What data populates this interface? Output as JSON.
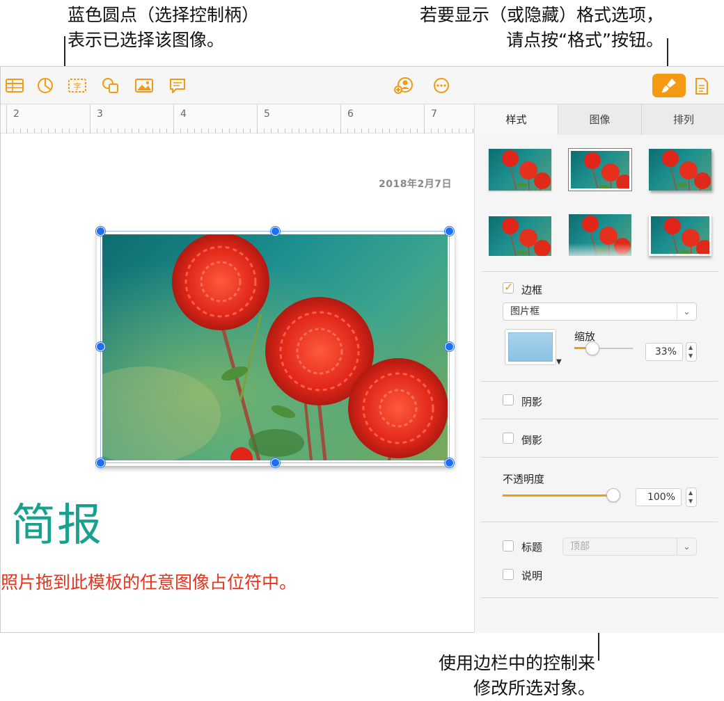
{
  "callouts": {
    "handles": [
      "蓝色圆点（选择控制柄）",
      "表示已选择该图像。"
    ],
    "format": [
      "若要显示（或隐藏）格式选项，",
      "请点按“格式”按钮。"
    ],
    "sidebar": [
      "使用边栏中的控制来",
      "修改所选对象。"
    ]
  },
  "toolbar": {
    "icons": [
      "table-icon",
      "chart-icon",
      "text-box-icon",
      "shape-icon",
      "media-icon",
      "comment-icon",
      "collaborate-icon",
      "more-icon",
      "format-paintbrush-icon",
      "document-icon"
    ]
  },
  "ruler": {
    "numbers": [
      "2",
      "3",
      "4",
      "5",
      "6",
      "7"
    ]
  },
  "canvas": {
    "date": "2018年2月7日",
    "title": "简报",
    "subtitle": "照片拖到此模板的任意图像占位符中。"
  },
  "sidebar": {
    "tabs": [
      {
        "label": "样式",
        "active": true
      },
      {
        "label": "图像",
        "active": false
      },
      {
        "label": "排列",
        "active": false
      }
    ],
    "border": {
      "label": "边框",
      "checked": true,
      "style": "图片框"
    },
    "scale": {
      "label": "缩放",
      "value": "33%",
      "level": 0.33
    },
    "shadow": {
      "label": "阴影",
      "checked": false
    },
    "reflection": {
      "label": "倒影",
      "checked": false
    },
    "opacity": {
      "label": "不透明度",
      "value": "100%",
      "level": 1.0
    },
    "caption_title": {
      "label": "标题",
      "checked": false,
      "position": "顶部"
    },
    "caption_desc": {
      "label": "说明",
      "checked": false
    }
  },
  "colors": {
    "accent": "#f39a12",
    "handle": "#1f6ff2",
    "title": "#19a08e",
    "subtitle": "#e8321b"
  }
}
